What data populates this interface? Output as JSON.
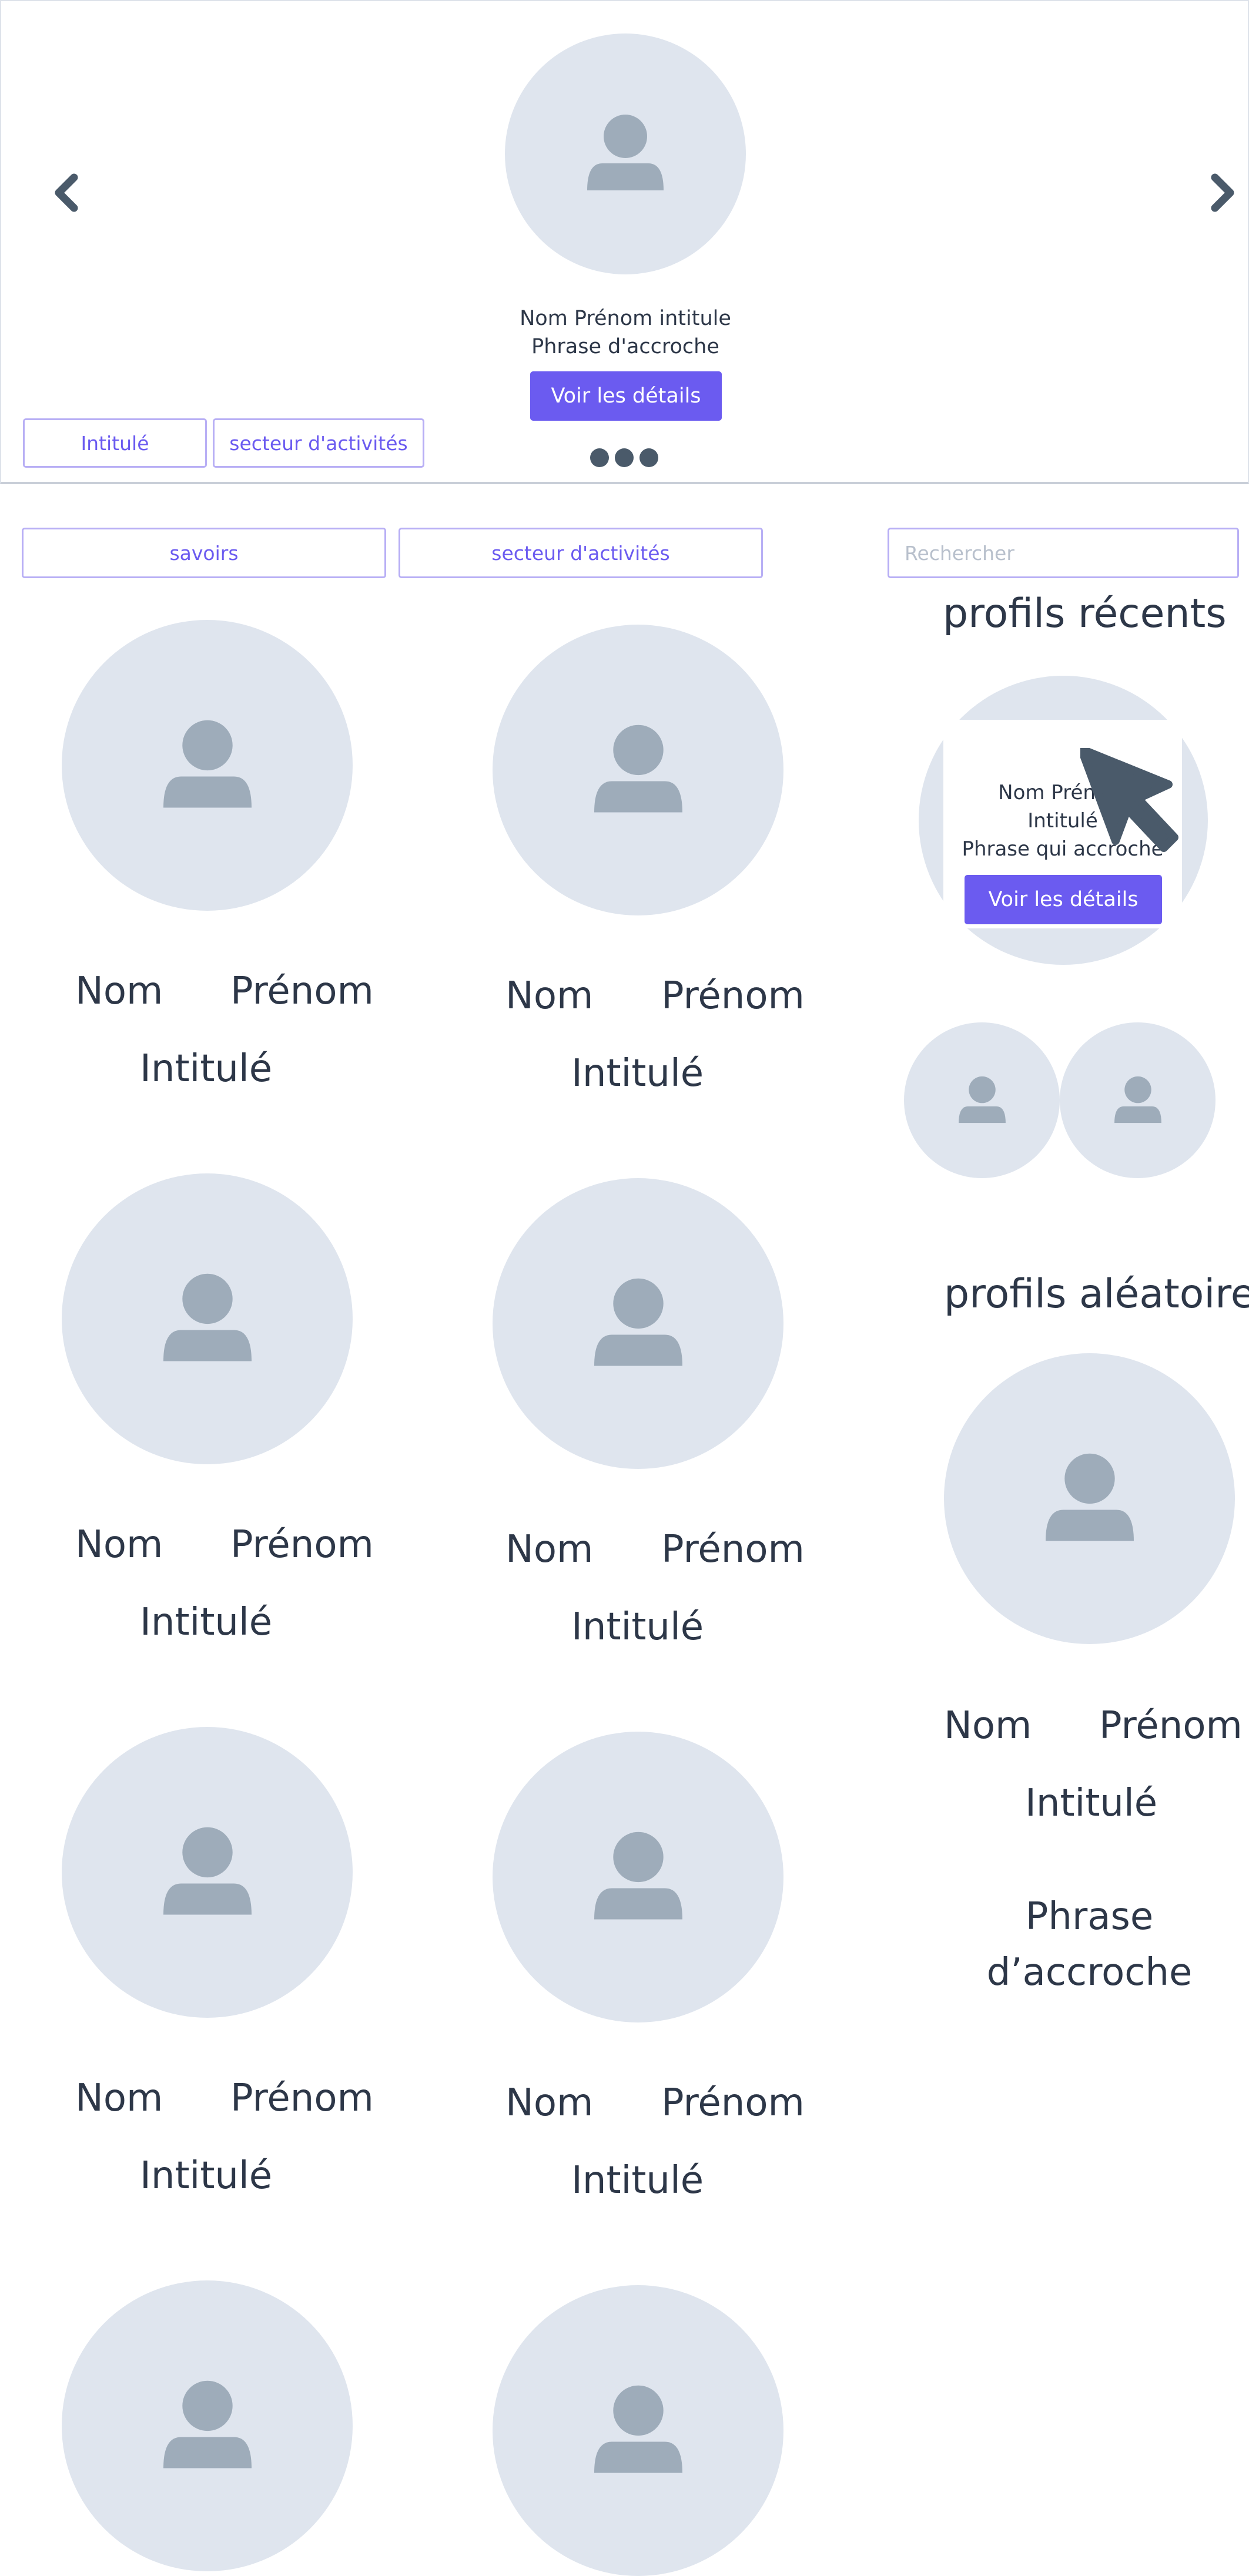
{
  "carousel": {
    "prev_icon": "chevron-left-icon",
    "next_icon": "chevron-right-icon",
    "profile_line": "Nom Prénom intitule",
    "tagline": "Phrase d'accroche",
    "details_label": "Voir les détails",
    "filters": [
      "Intitulé",
      "secteur d'activités"
    ],
    "dots": 3
  },
  "filters": {
    "savoirs": "savoirs",
    "secteur": "secteur d'activités",
    "search_placeholder": "Rechercher"
  },
  "grid": {
    "cards": [
      {
        "nom": "Nom",
        "prenom": "Prénom",
        "intitule": "Intitulé"
      },
      {
        "nom": "Nom",
        "prenom": "Prénom",
        "intitule": "Intitulé"
      },
      {
        "nom": "Nom",
        "prenom": "Prénom",
        "intitule": "Intitulé"
      },
      {
        "nom": "Nom",
        "prenom": "Prénom",
        "intitule": "Intitulé"
      },
      {
        "nom": "Nom",
        "prenom": "Prénom",
        "intitule": "Intitulé"
      },
      {
        "nom": "Nom",
        "prenom": "Prénom",
        "intitule": "Intitulé"
      },
      {
        "nom": "",
        "prenom": "",
        "intitule": ""
      },
      {
        "nom": "",
        "prenom": "",
        "intitule": ""
      }
    ]
  },
  "recent": {
    "heading": "profils récents",
    "popup_name": "Nom Prénom",
    "popup_intitule": "Intitulé",
    "popup_phrase": "Phrase qui accroche",
    "details_label": "Voir les détails"
  },
  "random": {
    "heading": "profils aléatoire",
    "nom": "Nom",
    "prenom": "Prénom",
    "intitule": "Intitulé",
    "phrase_line1": "Phrase",
    "phrase_line2": "d’accroche"
  },
  "colors": {
    "accent": "#6b5bf0",
    "avatar_bg": "#dfe5ee",
    "avatar_fg": "#9eacba",
    "text": "#2d3748"
  }
}
